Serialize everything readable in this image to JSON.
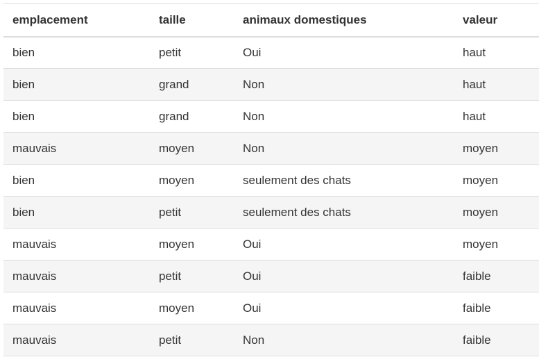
{
  "table": {
    "headers": [
      "emplacement",
      "taille",
      "animaux domestiques",
      "valeur"
    ],
    "rows": [
      [
        "bien",
        "petit",
        "Oui",
        "haut"
      ],
      [
        "bien",
        "grand",
        "Non",
        "haut"
      ],
      [
        "bien",
        "grand",
        "Non",
        "haut"
      ],
      [
        "mauvais",
        "moyen",
        "Non",
        "moyen"
      ],
      [
        "bien",
        "moyen",
        "seulement des chats",
        "moyen"
      ],
      [
        "bien",
        "petit",
        "seulement des chats",
        "moyen"
      ],
      [
        "mauvais",
        "moyen",
        "Oui",
        "moyen"
      ],
      [
        "mauvais",
        "petit",
        "Oui",
        "faible"
      ],
      [
        "mauvais",
        "moyen",
        "Oui",
        "faible"
      ],
      [
        "mauvais",
        "petit",
        "Non",
        "faible"
      ]
    ]
  }
}
